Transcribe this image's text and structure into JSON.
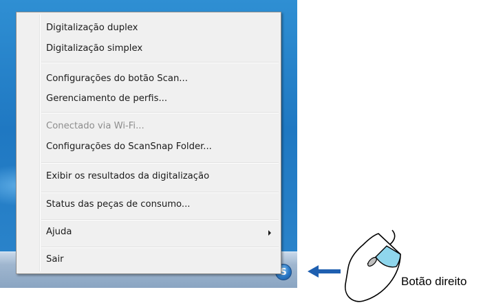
{
  "context_menu": {
    "items": [
      {
        "label": "Digitalização duplex",
        "enabled": true
      },
      {
        "label": "Digitalização simplex",
        "enabled": true
      },
      {
        "label": "Configurações do botão Scan...",
        "enabled": true
      },
      {
        "label": "Gerenciamento de perfis...",
        "enabled": true
      },
      {
        "label": "Conectado via Wi-Fi...",
        "enabled": false
      },
      {
        "label": "Configurações do ScanSnap Folder...",
        "enabled": true
      },
      {
        "label": "Exibir os resultados da digitalização",
        "enabled": true
      },
      {
        "label": "Status das peças de consumo...",
        "enabled": true
      },
      {
        "label": "Ajuda",
        "enabled": true,
        "has_submenu": true
      },
      {
        "label": "Sair",
        "enabled": true
      }
    ]
  },
  "tray": {
    "icon": "scansnap-manager-icon"
  },
  "callout": {
    "arrow_icon": "arrow-left-icon",
    "mouse_icon": "mouse-right-click-icon",
    "caption": "Botão direito",
    "arrow_color": "#1e5fb0",
    "highlight_color": "#8fd6ec"
  }
}
